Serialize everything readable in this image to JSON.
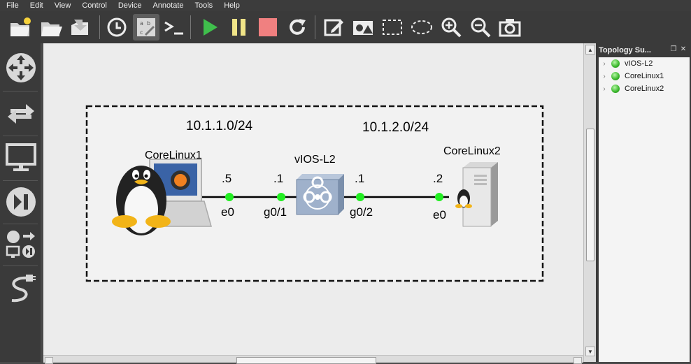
{
  "menu": [
    "File",
    "Edit",
    "View",
    "Control",
    "Device",
    "Annotate",
    "Tools",
    "Help"
  ],
  "toolbar": {
    "buttons": [
      "new-project",
      "open-project",
      "save-project",
      "snapshot",
      "show-interface-labels",
      "console-all",
      "start-all",
      "suspend-all",
      "stop-all",
      "reload-all",
      "add-note",
      "insert-image",
      "draw-rectangle",
      "draw-ellipse",
      "zoom-in",
      "zoom-out",
      "screenshot"
    ]
  },
  "left_toolbar": [
    "browse-routers",
    "browse-switches",
    "browse-end-devices",
    "browse-security-devices",
    "browse-all-devices",
    "add-link"
  ],
  "topology_summary": {
    "title": "Topology Su...",
    "items": [
      "vIOS-L2",
      "CoreLinux1",
      "CoreLinux2"
    ],
    "status_color": "#3cc12d"
  },
  "canvas": {
    "subnet1": "10.1.1.0/24",
    "subnet2": "10.1.2.0/24",
    "node1": {
      "name": "CoreLinux1",
      "ip": ".5",
      "iface": "e0"
    },
    "switch": {
      "name": "vIOS-L2",
      "ip_left": ".1",
      "iface_left": "g0/1",
      "ip_right": ".1",
      "iface_right": "g0/2"
    },
    "node2": {
      "name": "CoreLinux2",
      "ip": ".2",
      "iface": "e0"
    },
    "link_status_color": "#22ee22"
  }
}
